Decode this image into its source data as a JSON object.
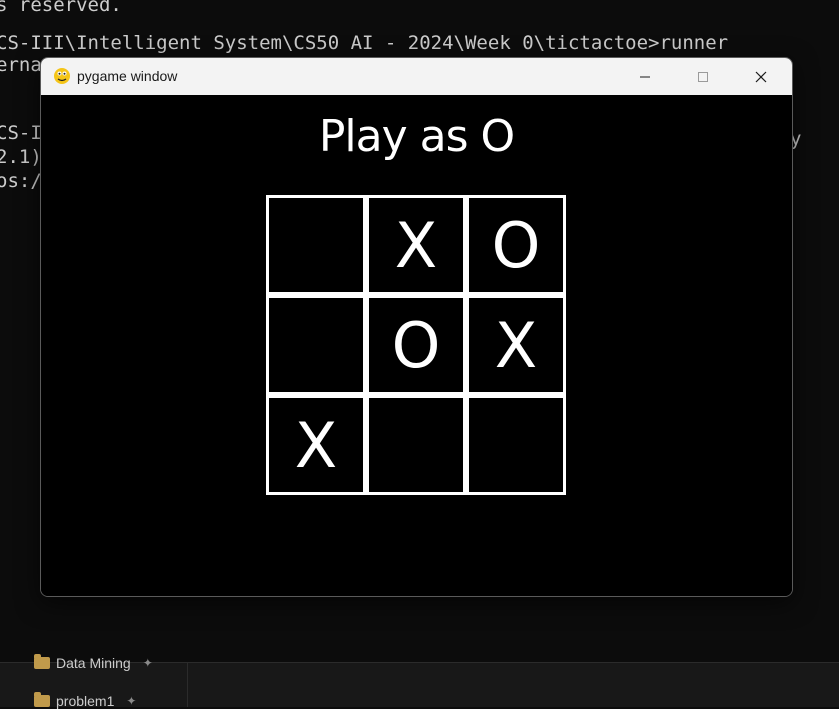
{
  "terminal": {
    "lines": [
      "s reserved.",
      "CS-III\\Intelligent System\\CS50 AI - 2024\\Week 0\\tictactoe>runner",
      "erna",
      "CS-I",
      "2.1)",
      "os:/"
    ],
    "right_fragment": "y"
  },
  "explorer": {
    "items": [
      {
        "label": "Data Mining"
      },
      {
        "label": "problem1"
      }
    ]
  },
  "window": {
    "title": "pygame window",
    "icon": "pygame-snake-icon",
    "controls": {
      "minimize": "minimize-icon",
      "maximize": "maximize-icon",
      "close": "close-icon"
    }
  },
  "game": {
    "heading": "Play as O",
    "board": [
      [
        "",
        "X",
        "O"
      ],
      [
        "",
        "O",
        "X"
      ],
      [
        "X",
        "",
        ""
      ]
    ]
  }
}
